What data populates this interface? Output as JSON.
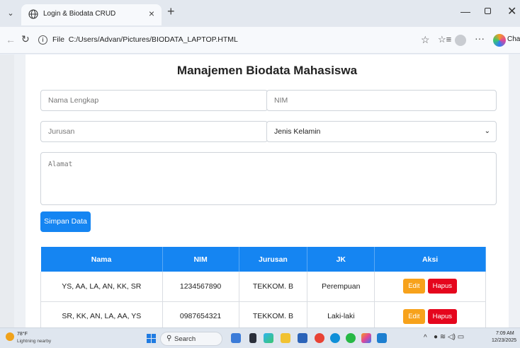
{
  "browser": {
    "tab_title": "Login & Biodata CRUD",
    "tab_close": "×",
    "new_tab": "+",
    "tab_menu": "⌄",
    "address_prefix": "File",
    "address_path": "C:/Users/Advan/Pictures/BIODATA_LAPTOP.HTML",
    "chat_label": "Chat",
    "icons": {
      "tab_menu": "chevron-down-icon",
      "site": "globe-icon",
      "back": "back-arrow-icon",
      "reload": "reload-icon",
      "info": "info-icon",
      "favorite": "star-icon",
      "favorites_list": "favorites-icon",
      "profile": "profile-icon",
      "more": "more-icon",
      "copilot": "copilot-icon"
    }
  },
  "page": {
    "title": "Manajemen Biodata Mahasiswa",
    "form": {
      "nama_placeholder": "Nama Lengkap",
      "nim_placeholder": "NIM",
      "jurusan_placeholder": "Jurusan",
      "jk_selected": "Jenis Kelamin",
      "alamat_placeholder": "Alamat",
      "save_label": "Simpan Data"
    },
    "table": {
      "headers": [
        "Nama",
        "NIM",
        "Jurusan",
        "JK",
        "Aksi"
      ],
      "rows": [
        {
          "nama": "YS, AA, LA, AN, KK, SR",
          "nim": "1234567890",
          "jurusan": "TEKKOM. B",
          "jk": "Perempuan",
          "edit": "Edit",
          "hapus": "Hapus"
        },
        {
          "nama": "SR, KK, AN, LA, AA, YS",
          "nim": "0987654321",
          "jurusan": "TEKKOM. B",
          "jk": "Laki-laki",
          "edit": "Edit",
          "hapus": "Hapus"
        }
      ]
    },
    "colors": {
      "primary": "#1585f2",
      "edit": "#f7a21b",
      "delete": "#e5061d"
    }
  },
  "taskbar": {
    "weather_temp": "78°F",
    "weather_desc": "Lightning nearby",
    "search_label": "Search",
    "time": "7:09 AM",
    "date": "12/23/2025"
  }
}
